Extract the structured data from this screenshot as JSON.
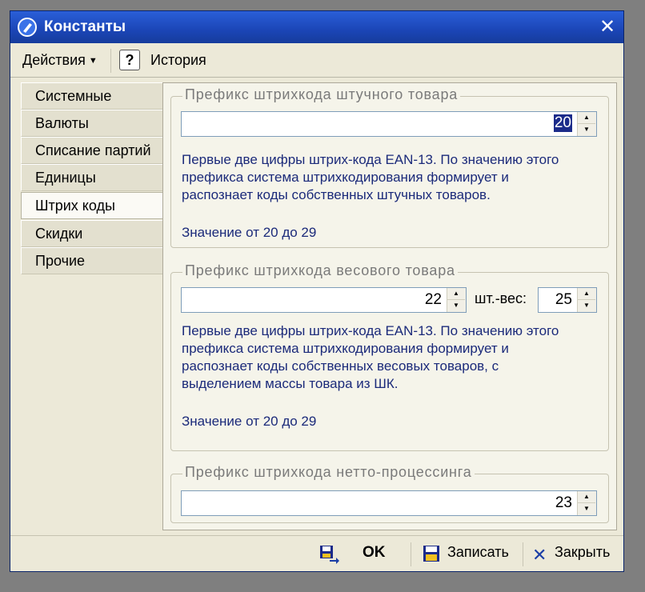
{
  "window": {
    "title": "Константы",
    "close_glyph": "✕"
  },
  "toolbar": {
    "actions_label": "Действия",
    "help_label": "?",
    "history_label": "История"
  },
  "nav": {
    "items": [
      {
        "label": "Системные"
      },
      {
        "label": "Валюты"
      },
      {
        "label": "Списание партий"
      },
      {
        "label": "Единицы"
      },
      {
        "label": "Штрих коды"
      },
      {
        "label": "Скидки"
      },
      {
        "label": "Прочие"
      }
    ],
    "active_index": 4
  },
  "groups": {
    "piece": {
      "title": "Префикс штрихкода штучного товара",
      "value": "20",
      "description": [
        "Первые две цифры штрих-кода EAN-13. По значению этого",
        "префикса система штрихкодирования формирует и",
        "распознает коды собственных штучных товаров."
      ],
      "range": "Значение от 20 до 29"
    },
    "weight": {
      "title": "Префикс штрихкода весового товара",
      "value": "22",
      "pcs_label": "шт.-вес:",
      "pcs_value": "25",
      "description": [
        "Первые две цифры штрих-кода EAN-13. По значению этого",
        "префикса система штрихкодирования формирует и",
        "распознает коды собственных весовых товаров, с",
        "выделением массы товара из ШК."
      ],
      "range": "Значение от 20 до 29"
    },
    "netto": {
      "title": "Префикс штрихкода нетто-процессинга",
      "value": "23"
    }
  },
  "bottom": {
    "ok_label": "OK",
    "save_label": "Записать",
    "close_label": "Закрыть"
  },
  "colors": {
    "title_bar": "#1b45b6",
    "description_text": "#1b2a7a",
    "window_bg": "#ece9d8"
  }
}
